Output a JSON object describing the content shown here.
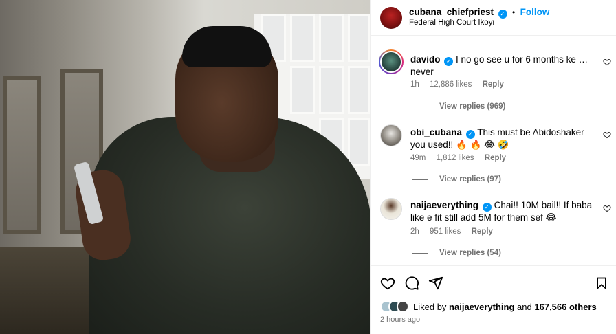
{
  "header": {
    "username": "cubana_chiefpriest",
    "verified_mark": "✓",
    "separator": "•",
    "follow_label": "Follow",
    "location": "Federal High Court Ikoyi"
  },
  "comments": [
    {
      "username": "davido",
      "text": "I no go see u for 6 months ke … never",
      "time": "1h",
      "likes": "12,886 likes",
      "reply_label": "Reply",
      "view_replies": "View replies (969)"
    },
    {
      "username": "obi_cubana",
      "text": "This must be Abidoshaker you used!! 🔥 🔥 😂 🤣",
      "time": "49m",
      "likes": "1,812 likes",
      "reply_label": "Reply",
      "view_replies": "View replies (97)"
    },
    {
      "username": "naijaeverything",
      "text": "Chai!! 10M bail!! If baba like e fit still add 5M for them sef 😂",
      "time": "2h",
      "likes": "951 likes",
      "reply_label": "Reply",
      "view_replies": "View replies (54)"
    }
  ],
  "footer": {
    "liked_by_prefix": "Liked by",
    "liked_by_user": "naijaeverything",
    "liked_by_and": "and",
    "liked_by_count": "167,566 others",
    "time_ago": "2 hours ago"
  },
  "icons": {
    "like": "heart-icon",
    "comment": "comment-icon",
    "share": "send-icon",
    "save": "bookmark-icon",
    "comment_like": "heart-small-icon"
  },
  "colors": {
    "accent": "#0095f6",
    "meta_text": "#737373",
    "divider": "#efefef"
  }
}
